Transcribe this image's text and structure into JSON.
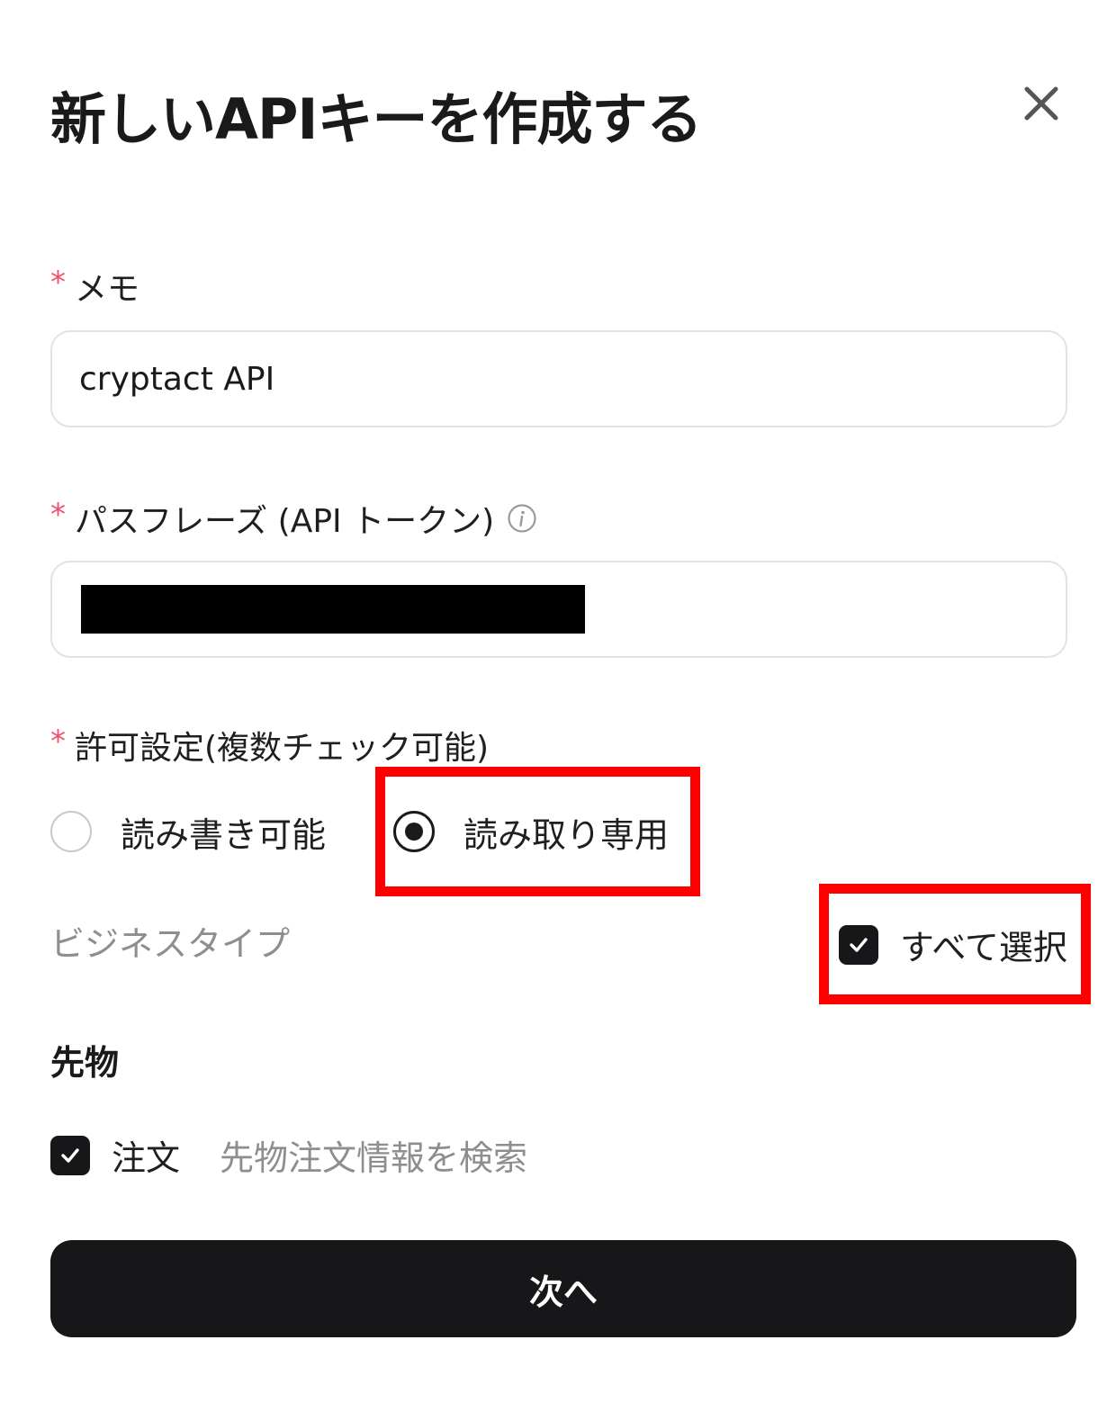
{
  "dialog": {
    "title": "新しいAPIキーを作成する",
    "close_icon": "close-icon"
  },
  "memo": {
    "required_mark": "*",
    "label": "メモ",
    "value": "cryptact API"
  },
  "passphrase": {
    "required_mark": "*",
    "label": "パスフレーズ (API トークン)",
    "info_icon": "info-icon",
    "value_redacted": true
  },
  "permissions": {
    "required_mark": "*",
    "label": "許可設定(複数チェック可能)",
    "options": [
      {
        "label": "読み書き可能",
        "selected": false
      },
      {
        "label": "読み取り専用",
        "selected": true
      }
    ]
  },
  "business_type": {
    "label": "ビジネスタイプ",
    "select_all_label": "すべて選択",
    "select_all_checked": true
  },
  "futures": {
    "title": "先物",
    "items": [
      {
        "name": "注文",
        "description": "先物注文情報を検索",
        "checked": true
      }
    ]
  },
  "footer": {
    "next_label": "次へ"
  },
  "colors": {
    "accent": "#17171a",
    "required": "#f0506e",
    "highlight": "#ff0000",
    "muted_text": "#8e8e8e"
  }
}
